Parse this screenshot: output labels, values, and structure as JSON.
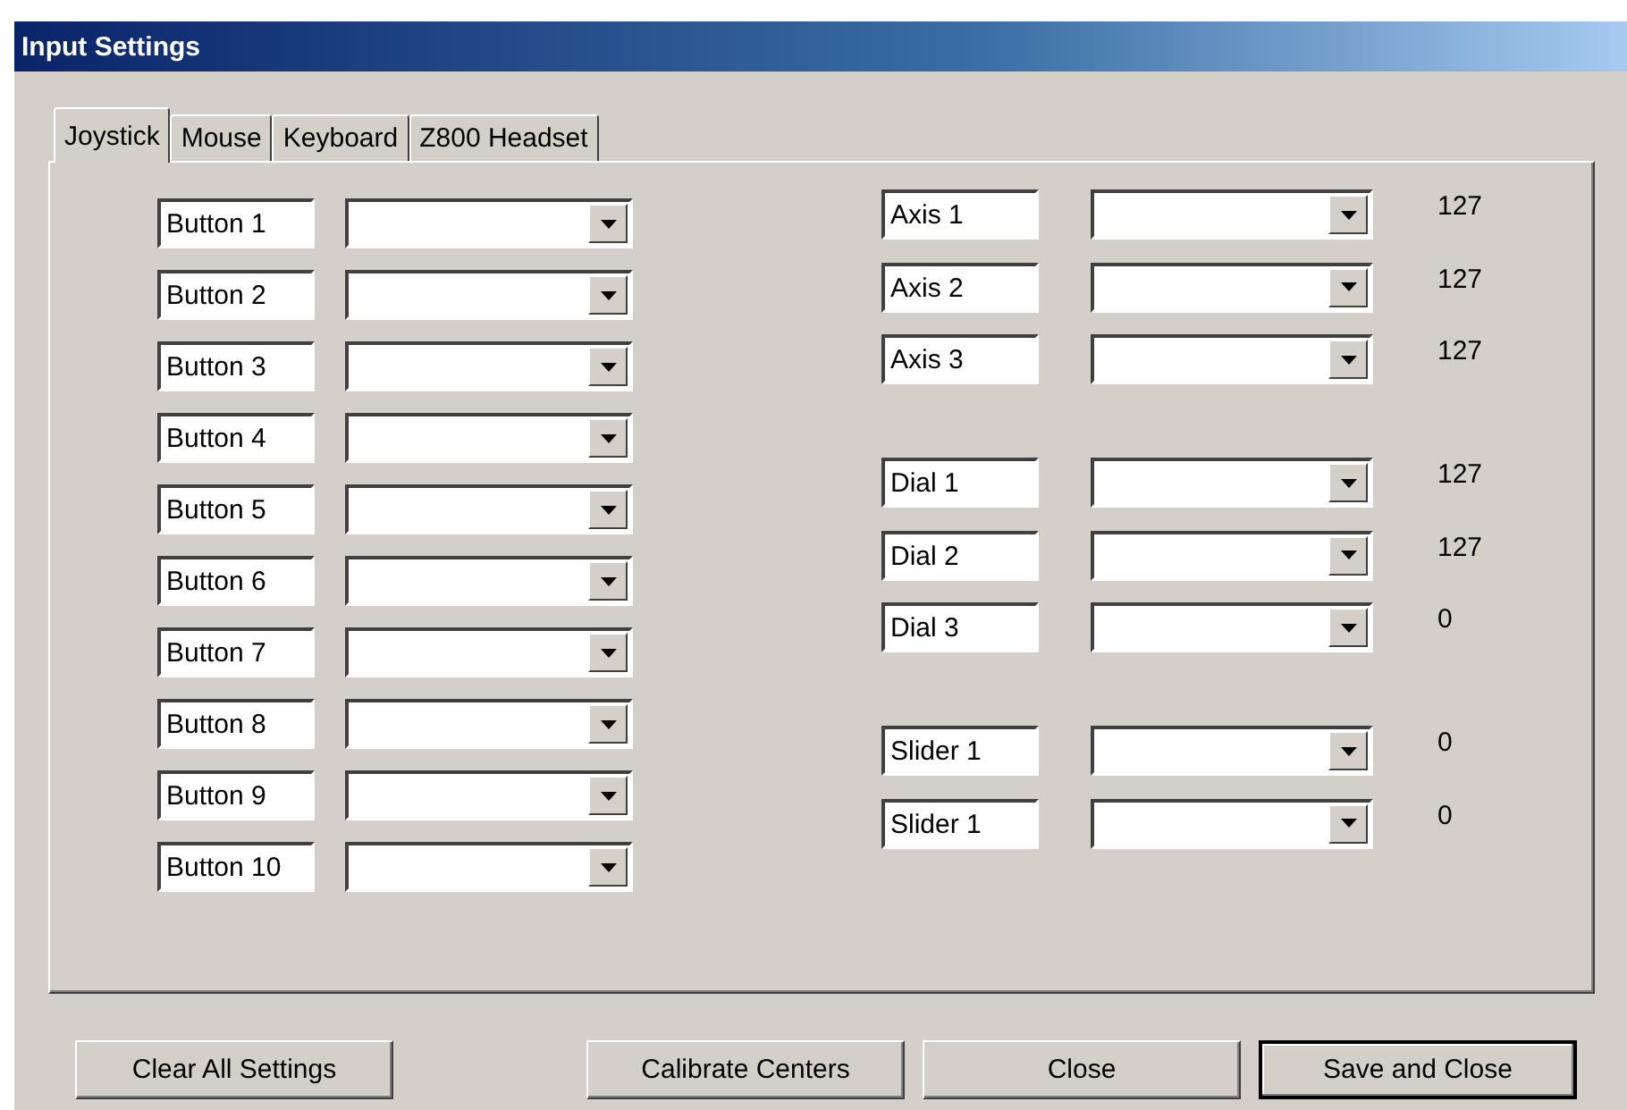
{
  "window": {
    "title": "Input Settings"
  },
  "tabs": [
    {
      "label": "Joystick",
      "selected": true
    },
    {
      "label": "Mouse",
      "selected": false
    },
    {
      "label": "Keyboard",
      "selected": false
    },
    {
      "label": "Z800 Headset",
      "selected": false
    }
  ],
  "buttons_column": [
    {
      "name": "Button 1"
    },
    {
      "name": "Button 2"
    },
    {
      "name": "Button 3"
    },
    {
      "name": "Button 4"
    },
    {
      "name": "Button 5"
    },
    {
      "name": "Button 6"
    },
    {
      "name": "Button 7"
    },
    {
      "name": "Button 8"
    },
    {
      "name": "Button 9"
    },
    {
      "name": "Button 10"
    }
  ],
  "axes_groups": [
    [
      {
        "name": "Axis 1",
        "reading": "127"
      },
      {
        "name": "Axis 2",
        "reading": "127"
      },
      {
        "name": "Axis 3",
        "reading": "127"
      }
    ],
    [
      {
        "name": "Dial 1",
        "reading": "127"
      },
      {
        "name": "Dial 2",
        "reading": "127"
      },
      {
        "name": "Dial 3",
        "reading": "0"
      }
    ],
    [
      {
        "name": "Slider 1",
        "reading": "0"
      },
      {
        "name": "Slider 1",
        "reading": "0"
      }
    ]
  ],
  "actions": [
    {
      "label": "Clear All Settings",
      "default": false
    },
    {
      "label": "Calibrate Centers",
      "default": false
    },
    {
      "label": "Close",
      "default": false
    },
    {
      "label": "Save and Close",
      "default": true
    }
  ]
}
